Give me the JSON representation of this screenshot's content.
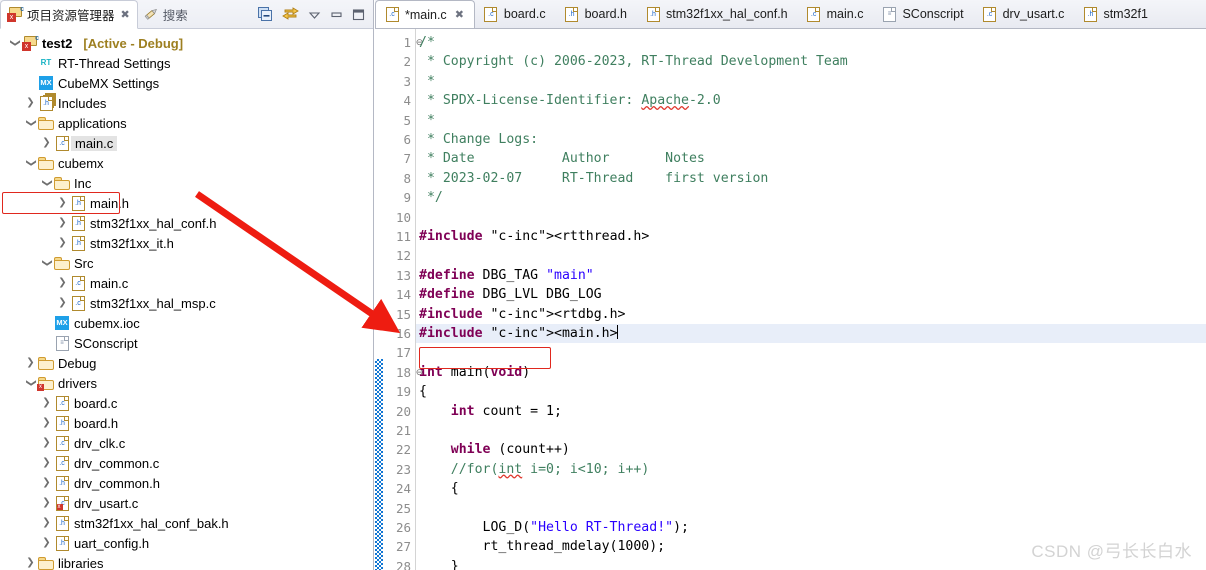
{
  "left_panel": {
    "tabs": [
      {
        "label": "项目资源管理器",
        "icon": "project-explorer-icon",
        "active": true,
        "closeable": true
      },
      {
        "label": "搜索",
        "icon": "search-icon",
        "active": false,
        "closeable": false
      }
    ],
    "toolbar": [
      {
        "name": "collapse-all-icon",
        "glyph": "▣"
      },
      {
        "name": "link-with-editor-icon",
        "glyph": "⇄"
      },
      {
        "name": "view-menu-icon",
        "glyph": "▽"
      },
      {
        "name": "minimize-icon",
        "glyph": "▭"
      },
      {
        "name": "maximize-icon",
        "glyph": "❐"
      }
    ],
    "tree": [
      {
        "indent": 0,
        "twist": "v",
        "icon": "project",
        "label": "test2",
        "bold": true,
        "tag": "[Active - Debug]"
      },
      {
        "indent": 1,
        "twist": "",
        "icon": "rt",
        "label": "RT-Thread Settings"
      },
      {
        "indent": 1,
        "twist": "",
        "icon": "mx",
        "label": "CubeMX Settings"
      },
      {
        "indent": 1,
        "twist": ">",
        "icon": "includes",
        "label": "Includes"
      },
      {
        "indent": 1,
        "twist": "v",
        "icon": "folder",
        "label": "applications"
      },
      {
        "indent": 2,
        "twist": ">",
        "icon": "c",
        "label": "main.c",
        "selected": true
      },
      {
        "indent": 1,
        "twist": "v",
        "icon": "folder",
        "label": "cubemx"
      },
      {
        "indent": 2,
        "twist": "v",
        "icon": "folder",
        "label": "Inc"
      },
      {
        "indent": 3,
        "twist": ">",
        "icon": "h",
        "label": "main.h",
        "outlined": true
      },
      {
        "indent": 3,
        "twist": ">",
        "icon": "h",
        "label": "stm32f1xx_hal_conf.h"
      },
      {
        "indent": 3,
        "twist": ">",
        "icon": "h",
        "label": "stm32f1xx_it.h"
      },
      {
        "indent": 2,
        "twist": "v",
        "icon": "folder",
        "label": "Src"
      },
      {
        "indent": 3,
        "twist": ">",
        "icon": "c",
        "label": "main.c"
      },
      {
        "indent": 3,
        "twist": ">",
        "icon": "c",
        "label": "stm32f1xx_hal_msp.c"
      },
      {
        "indent": 2,
        "twist": "",
        "icon": "mx",
        "label": "cubemx.ioc"
      },
      {
        "indent": 2,
        "twist": "",
        "icon": "doc",
        "label": "SConscript"
      },
      {
        "indent": 1,
        "twist": ">",
        "icon": "folder",
        "label": "Debug"
      },
      {
        "indent": 1,
        "twist": "v",
        "icon": "folder-mod",
        "label": "drivers"
      },
      {
        "indent": 2,
        "twist": ">",
        "icon": "c",
        "label": "board.c"
      },
      {
        "indent": 2,
        "twist": ">",
        "icon": "h",
        "label": "board.h"
      },
      {
        "indent": 2,
        "twist": ">",
        "icon": "c",
        "label": "drv_clk.c"
      },
      {
        "indent": 2,
        "twist": ">",
        "icon": "c",
        "label": "drv_common.c"
      },
      {
        "indent": 2,
        "twist": ">",
        "icon": "h",
        "label": "drv_common.h"
      },
      {
        "indent": 2,
        "twist": ">",
        "icon": "c-mod",
        "label": "drv_usart.c"
      },
      {
        "indent": 2,
        "twist": ">",
        "icon": "h",
        "label": "stm32f1xx_hal_conf_bak.h"
      },
      {
        "indent": 2,
        "twist": ">",
        "icon": "h",
        "label": "uart_config.h"
      },
      {
        "indent": 1,
        "twist": ">",
        "icon": "folder",
        "label": "libraries"
      }
    ]
  },
  "editor": {
    "tabs": [
      {
        "label": "*main.c",
        "icon": "c-file-icon",
        "active": true,
        "closeable": true
      },
      {
        "label": "board.c",
        "icon": "c-file-icon",
        "active": false
      },
      {
        "label": "board.h",
        "icon": "h-file-icon",
        "active": false
      },
      {
        "label": "stm32f1xx_hal_conf.h",
        "icon": "h-file-icon",
        "active": false
      },
      {
        "label": "main.c",
        "icon": "c-file-icon",
        "active": false
      },
      {
        "label": "SConscript",
        "icon": "doc-file-icon",
        "active": false
      },
      {
        "label": "drv_usart.c",
        "icon": "c-file-icon",
        "active": false
      },
      {
        "label": "stm32f1",
        "icon": "h-file-icon",
        "active": false
      }
    ],
    "lines": [
      {
        "n": 1,
        "fold": "⊖",
        "text": "/*"
      },
      {
        "n": 2,
        "fold": "",
        "text": " * Copyright (c) 2006-2023, RT-Thread Development Team"
      },
      {
        "n": 3,
        "fold": "",
        "text": " *"
      },
      {
        "n": 4,
        "fold": "",
        "text": " * SPDX-License-Identifier: Apache-2.0"
      },
      {
        "n": 5,
        "fold": "",
        "text": " *"
      },
      {
        "n": 6,
        "fold": "",
        "text": " * Change Logs:"
      },
      {
        "n": 7,
        "fold": "",
        "text": " * Date           Author       Notes"
      },
      {
        "n": 8,
        "fold": "",
        "text": " * 2023-02-07     RT-Thread    first version"
      },
      {
        "n": 9,
        "fold": "",
        "text": " */"
      },
      {
        "n": 10,
        "fold": "",
        "text": ""
      },
      {
        "n": 11,
        "fold": "",
        "text": "#include <rtthread.h>"
      },
      {
        "n": 12,
        "fold": "",
        "text": ""
      },
      {
        "n": 13,
        "fold": "",
        "text": "#define DBG_TAG \"main\""
      },
      {
        "n": 14,
        "fold": "",
        "text": "#define DBG_LVL DBG_LOG"
      },
      {
        "n": 15,
        "fold": "",
        "text": "#include <rtdbg.h>"
      },
      {
        "n": 16,
        "fold": "",
        "text": "#include <main.h>"
      },
      {
        "n": 17,
        "fold": "",
        "text": ""
      },
      {
        "n": 18,
        "fold": "⊖",
        "text": "int main(void)"
      },
      {
        "n": 19,
        "fold": "",
        "text": "{"
      },
      {
        "n": 20,
        "fold": "",
        "text": "    int count = 1;"
      },
      {
        "n": 21,
        "fold": "",
        "text": ""
      },
      {
        "n": 22,
        "fold": "",
        "text": "    while (count++)"
      },
      {
        "n": 23,
        "fold": "",
        "text": "    //for(int i=0; i<10; i++)"
      },
      {
        "n": 24,
        "fold": "",
        "text": "    {"
      },
      {
        "n": 25,
        "fold": "",
        "text": ""
      },
      {
        "n": 26,
        "fold": "",
        "text": "        LOG_D(\"Hello RT-Thread!\");"
      },
      {
        "n": 27,
        "fold": "",
        "text": "        rt_thread_mdelay(1000);"
      },
      {
        "n": 28,
        "fold": "",
        "text": "    }"
      }
    ]
  },
  "annotations": {
    "arrow_color": "#ee1c11",
    "highlight_color": "#e0281e"
  },
  "watermark": "CSDN @弓长长白水"
}
